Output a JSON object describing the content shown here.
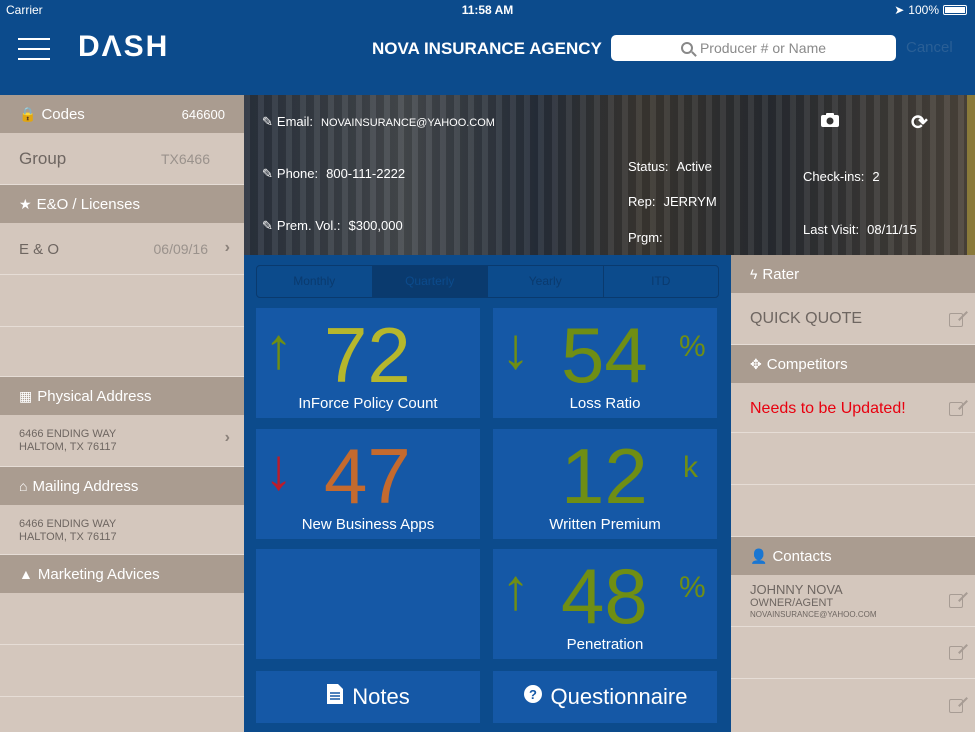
{
  "status_bar": {
    "carrier": "Carrier",
    "time": "11:58 AM",
    "battery": "100%"
  },
  "header": {
    "logo": "DΛSH",
    "agency": "NOVA INSURANCE AGENCY",
    "search_placeholder": "Producer # or Name",
    "cancel_label": "Cancel"
  },
  "left_panel": {
    "codes_label": "Codes",
    "codes_value": "646600",
    "group_label": "Group",
    "group_value": "TX6466",
    "eo_header": "E&O / Licenses",
    "eo_label": "E & O",
    "eo_date": "06/09/16",
    "physical_header": "Physical Address",
    "physical_line1": "6466 ENDING WAY",
    "physical_line2": "HALTOM, TX 76117",
    "mailing_header": "Mailing Address",
    "mailing_line1": "6466 ENDING WAY",
    "mailing_line2": "HALTOM, TX 76117",
    "marketing_header": "Marketing Advices"
  },
  "profile": {
    "email_label": "Email:",
    "email": "NOVAINSURANCE@YAHOO.COM",
    "phone_label": "Phone:",
    "phone": "800-111-2222",
    "prem_label": "Prem. Vol.:",
    "prem": "$300,000",
    "status_label": "Status:",
    "status": "Active",
    "rep_label": "Rep:",
    "rep": "JERRYM",
    "prgm_label": "Prgm:",
    "prgm": "",
    "checkins_label": "Check-ins:",
    "checkins": "2",
    "last_visit_label": "Last Visit:",
    "last_visit": "08/11/15"
  },
  "period_tabs": [
    {
      "label": "Monthly"
    },
    {
      "label": "Quarterly"
    },
    {
      "label": "Yearly"
    },
    {
      "label": "ITD"
    }
  ],
  "metrics": {
    "inforce": {
      "value": "72",
      "label": "InForce Policy Count",
      "trend": "up"
    },
    "loss_ratio": {
      "value": "54",
      "unit": "%",
      "label": "Loss Ratio",
      "trend": "down"
    },
    "new_business": {
      "value": "47",
      "label": "New Business Apps",
      "trend": "down"
    },
    "written_premium": {
      "value": "12",
      "unit": "k",
      "label": "Written Premium"
    },
    "penetration": {
      "value": "48",
      "unit": "%",
      "label": "Penetration",
      "trend": "up"
    }
  },
  "actions": {
    "notes": "Notes",
    "questionnaire": "Questionnaire"
  },
  "right_panel": {
    "rater_header": "Rater",
    "quick_quote": "QUICK QUOTE",
    "competitors_header": "Competitors",
    "competitors_note": "Needs to be Updated!",
    "contacts_header": "Contacts",
    "contact_name": "JOHNNY NOVA",
    "contact_role": "OWNER/AGENT",
    "contact_email": "NOVAINSURANCE@YAHOO.COM"
  },
  "colors": {
    "header_blue": "#0c4b8c",
    "tile_blue": "#1558a6",
    "panel_tan": "#d4c7bd",
    "section_tan": "#aa9c90",
    "good_green": "#6f8e14",
    "alert_red": "#bb1c2b",
    "warning_text": "#e8000f"
  }
}
